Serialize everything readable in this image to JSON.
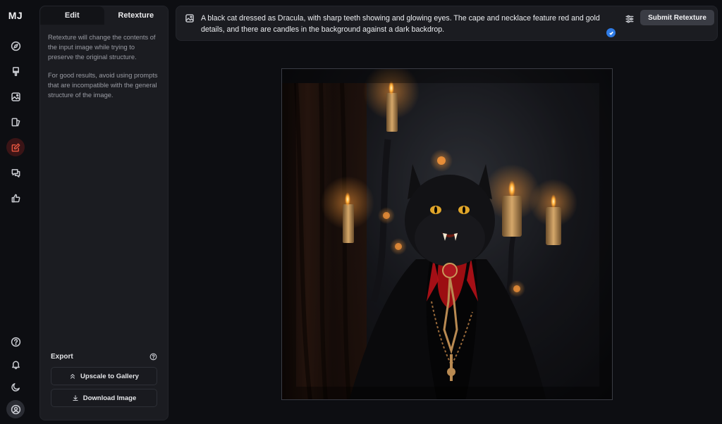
{
  "logo": "MJ",
  "nav": [
    {
      "name": "explore",
      "icon": "compass-icon"
    },
    {
      "name": "create",
      "icon": "brush-icon"
    },
    {
      "name": "images",
      "icon": "image-icon"
    },
    {
      "name": "organize",
      "icon": "gallery-icon"
    },
    {
      "name": "edit",
      "icon": "edit-icon",
      "active": true
    },
    {
      "name": "chat",
      "icon": "chat-icon"
    },
    {
      "name": "rate",
      "icon": "thumbs-up-icon"
    }
  ],
  "nav_bottom": [
    {
      "name": "help",
      "icon": "help-icon"
    },
    {
      "name": "notifications",
      "icon": "bell-icon"
    },
    {
      "name": "theme",
      "icon": "moon-icon"
    },
    {
      "name": "account",
      "icon": "user-icon"
    }
  ],
  "panel": {
    "tabs": [
      {
        "label": "Edit",
        "active": false
      },
      {
        "label": "Retexture",
        "active": true
      }
    ],
    "desc1": "Retexture will change the contents of the input image while trying to preserve the original structure.",
    "desc2": "For good results, avoid using prompts that are incompatible with the general structure of the image.",
    "export": {
      "title": "Export",
      "upscale_label": "Upscale to Gallery",
      "download_label": "Download Image"
    }
  },
  "prompt": {
    "text": "A black cat dressed as Dracula, with sharp teeth showing and glowing eyes. The cape and necklace feature red and gold details, and there are candles in the background against a dark backdrop.",
    "submit_label": "Submit Retexture"
  },
  "colors": {
    "accent": "#e0533e",
    "verified": "#2f7be5",
    "background": "#0d0e12",
    "panel": "#1b1c21"
  }
}
